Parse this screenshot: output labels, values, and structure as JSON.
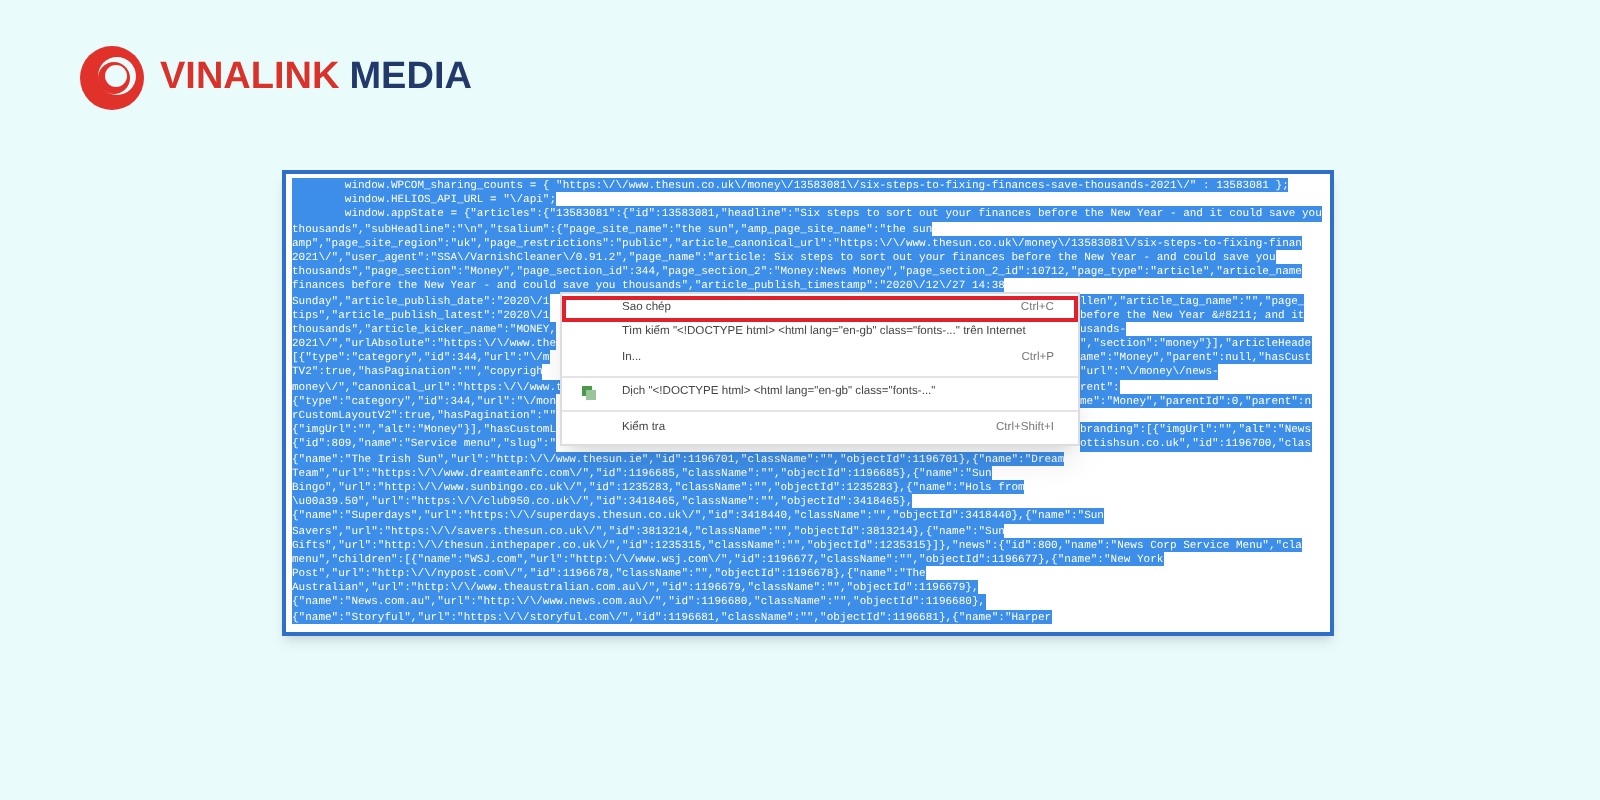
{
  "logo": {
    "brand": "VINALINK",
    "suffix": "MEDIA"
  },
  "code_lines": [
    {
      "kind": "full",
      "text": "        window.WPCOM_sharing_counts = { \"https:\\/\\/www.thesun.co.uk\\/money\\/13583081\\/six-steps-to-fixing-finances-save-thousands-2021\\/\" : 13583081 };"
    },
    {
      "kind": "full",
      "text": "        window.HELIOS_API_URL = \"\\/api\";"
    },
    {
      "kind": "full",
      "text": "        window.appState = {\"articles\":{\"13583081\":{\"id\":13583081,\"headline\":\"Six steps to sort out your finances before the New Year - and it could save you"
    },
    {
      "kind": "full",
      "text": "thousands\",\"subHeadline\":\"\\n\",\"tsalium\":{\"page_site_name\":\"the sun\",\"amp_page_site_name\":\"the sun"
    },
    {
      "kind": "full",
      "text": "amp\",\"page_site_region\":\"uk\",\"page_restrictions\":\"public\",\"article_canonical_url\":\"https:\\/\\/www.thesun.co.uk\\/money\\/13583081\\/six-steps-to-fixing-finan"
    },
    {
      "kind": "full",
      "text": "2021\\/\",\"user_agent\":\"SSA\\/VarnishCleaner\\/0.91.2\",\"page_name\":\"article: Six steps to sort out your finances before the New Year - and could save you"
    },
    {
      "kind": "full",
      "text": "thousands\",\"page_section\":\"Money\",\"page_section_id\":344,\"page_section_2\":\"Money:News Money\",\"page_section_2_id\":10712,\"page_type\":\"article\",\"article_name"
    },
    {
      "kind": "full",
      "text": "finances before the New Year - and could save you thousands\",\"article_publish_timestamp\":\"2020\\/12\\/27 14:38"
    },
    {
      "kind": "split",
      "left": "Sunday\",\"article_publish_date\":\"2020\\/1",
      "right": "llen\",\"article_tag_name\":\"\",\"page_"
    },
    {
      "kind": "split",
      "left": "tips\",\"article_publish_latest\":\"2020\\/1",
      "right": "before the New Year &#8211; and it"
    },
    {
      "kind": "split",
      "left": "thousands\",\"article_kicker_name\":\"MONEY,",
      "right": "usands-"
    },
    {
      "kind": "split",
      "left": "2021\\/\",\"urlAbsolute\":\"https:\\/\\/www.the",
      "right": "\",\"section\":\"money\"}],\"articleHeade"
    },
    {
      "kind": "split",
      "left": "[{\"type\":\"category\",\"id\":344,\"url\":\"\\/m",
      "right": "ame\":\"Money\",\"parent\":null,\"hasCust"
    },
    {
      "kind": "split",
      "left": "TV2\":true,\"hasPagination\":\"\",\"copyrigh",
      "right": "\"url\":\"\\/money\\/news-"
    },
    {
      "kind": "split",
      "left": "money\\/\",\"canonical_url\":\"https:\\/\\/www.t",
      "right": "rent\":"
    },
    {
      "kind": "split",
      "left": "{\"type\":\"category\",\"id\":344,\"url\":\"\\/mon",
      "right": "me\":\"Money\",\"parentId\":0,\"parent\":n"
    },
    {
      "kind": "split",
      "left": "rCustomLayoutV2\":true,\"hasPagination\":\"\""
    },
    {
      "kind": "split",
      "left": "{\"imgUrl\":\"\",\"alt\":\"Money\"}],\"hasCustomL",
      "right": "branding\":[{\"imgUrl\":\"\",\"alt\":\"News"
    },
    {
      "kind": "split",
      "left": "{\"id\":809,\"name\":\"Service menu\",\"slug\":\"",
      "right": "ottishsun.co.uk\",\"id\":1196700,\"clas"
    },
    {
      "kind": "full",
      "text": "{\"name\":\"The Irish Sun\",\"url\":\"http:\\/\\/www.thesun.ie\",\"id\":1196701,\"className\":\"\",\"objectId\":1196701},{\"name\":\"Dream"
    },
    {
      "kind": "full",
      "text": "Team\",\"url\":\"https:\\/\\/www.dreamteamfc.com\\/\",\"id\":1196685,\"className\":\"\",\"objectId\":1196685},{\"name\":\"Sun"
    },
    {
      "kind": "full",
      "text": "Bingo\",\"url\":\"http:\\/\\/www.sunbingo.co.uk\\/\",\"id\":1235283,\"className\":\"\",\"objectId\":1235283},{\"name\":\"Hols from"
    },
    {
      "kind": "full",
      "text": "\\u00a39.50\",\"url\":\"https:\\/\\/club950.co.uk\\/\",\"id\":3418465,\"className\":\"\",\"objectId\":3418465},"
    },
    {
      "kind": "full",
      "text": "{\"name\":\"Superdays\",\"url\":\"https:\\/\\/superdays.thesun.co.uk\\/\",\"id\":3418440,\"className\":\"\",\"objectId\":3418440},{\"name\":\"Sun"
    },
    {
      "kind": "full",
      "text": "Savers\",\"url\":\"https:\\/\\/savers.thesun.co.uk\\/\",\"id\":3813214,\"className\":\"\",\"objectId\":3813214},{\"name\":\"Sun"
    },
    {
      "kind": "full",
      "text": "Gifts\",\"url\":\"http:\\/\\/thesun.inthepaper.co.uk\\/\",\"id\":1235315,\"className\":\"\",\"objectId\":1235315}]},\"news\":{\"id\":800,\"name\":\"News Corp Service Menu\",\"cla"
    },
    {
      "kind": "full",
      "text": "menu\",\"children\":[{\"name\":\"WSJ.com\",\"url\":\"http:\\/\\/www.wsj.com\\/\",\"id\":1196677,\"className\":\"\",\"objectId\":1196677},{\"name\":\"New York"
    },
    {
      "kind": "full",
      "text": "Post\",\"url\":\"http:\\/\\/nypost.com\\/\",\"id\":1196678,\"className\":\"\",\"objectId\":1196678},{\"name\":\"The"
    },
    {
      "kind": "full",
      "text": "Australian\",\"url\":\"http:\\/\\/www.theaustralian.com.au\\/\",\"id\":1196679,\"className\":\"\",\"objectId\":1196679},"
    },
    {
      "kind": "full",
      "text": "{\"name\":\"News.com.au\",\"url\":\"http:\\/\\/www.news.com.au\\/\",\"id\":1196680,\"className\":\"\",\"objectId\":1196680},"
    },
    {
      "kind": "full",
      "text": "{\"name\":\"Storyful\",\"url\":\"https:\\/\\/storyful.com\\/\",\"id\":1196681,\"className\":\"\",\"objectId\":1196681},{\"name\":\"Harper"
    }
  ],
  "context_menu": [
    {
      "kind": "item",
      "label": "Sao chép",
      "shortcut": "Ctrl+C",
      "selected": true
    },
    {
      "kind": "item",
      "label": "Tìm kiếm \"<!DOCTYPE html> <html lang=\"en-gb\" class=\"fonts-...\" trên Internet",
      "selected": false
    },
    {
      "kind": "item",
      "label": "In...",
      "shortcut": "Ctrl+P",
      "selected": false
    },
    {
      "kind": "separator"
    },
    {
      "kind": "translate",
      "label": "Dịch \"<!DOCTYPE html> <html lang=\"en-gb\" class=\"fonts-...\"",
      "selected": false
    },
    {
      "kind": "separator"
    },
    {
      "kind": "item",
      "label": "Kiểm tra",
      "shortcut": "Ctrl+Shift+I",
      "selected": false
    }
  ]
}
